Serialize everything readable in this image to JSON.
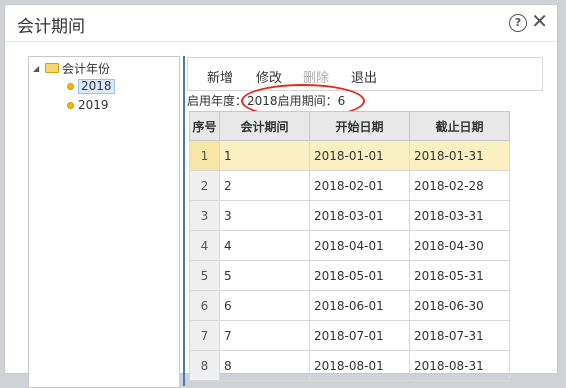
{
  "dialog": {
    "title": "会计期间",
    "help_symbol": "?",
    "close_symbol": "✕"
  },
  "tree": {
    "root_label": "会计年份",
    "toggle_symbol": "◢",
    "years": [
      {
        "label": "2018",
        "selected": true
      },
      {
        "label": "2019",
        "selected": false
      }
    ]
  },
  "toolbar": {
    "add_label": "新增",
    "edit_label": "修改",
    "delete_label": "删除",
    "exit_label": "退出"
  },
  "info": {
    "year_label": "启用年度：",
    "year_value": "2018",
    "period_label": "启用期间：",
    "period_value": "6"
  },
  "table": {
    "columns": [
      "序号",
      "会计期间",
      "开始日期",
      "截止日期"
    ],
    "rows": [
      {
        "idx": "1",
        "period": "1",
        "start": "2018-01-01",
        "end": "2018-01-31"
      },
      {
        "idx": "2",
        "period": "2",
        "start": "2018-02-01",
        "end": "2018-02-28"
      },
      {
        "idx": "3",
        "period": "3",
        "start": "2018-03-01",
        "end": "2018-03-31"
      },
      {
        "idx": "4",
        "period": "4",
        "start": "2018-04-01",
        "end": "2018-04-30"
      },
      {
        "idx": "5",
        "period": "5",
        "start": "2018-05-01",
        "end": "2018-05-31"
      },
      {
        "idx": "6",
        "period": "6",
        "start": "2018-06-01",
        "end": "2018-06-30"
      },
      {
        "idx": "7",
        "period": "7",
        "start": "2018-07-01",
        "end": "2018-07-31"
      },
      {
        "idx": "8",
        "period": "8",
        "start": "2018-08-01",
        "end": "2018-08-31"
      }
    ]
  },
  "colors": {
    "annotation": "#e12b1f",
    "selected_row": "#fbf0c2",
    "divider": "#4a78b5"
  }
}
